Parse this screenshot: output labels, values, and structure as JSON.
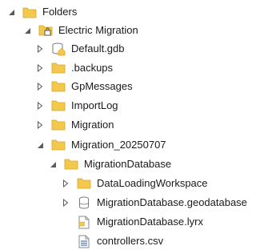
{
  "tree": {
    "folders": {
      "label": "Folders",
      "icon": "folders-icon",
      "expanded": true
    },
    "electric_migration": {
      "label": "Electric Migration",
      "icon": "folder-connection-icon",
      "expanded": true
    },
    "default_gdb": {
      "label": "Default.gdb",
      "icon": "home-geodatabase-icon",
      "expanded": false
    },
    "backups": {
      "label": ".backups",
      "icon": "folder-icon",
      "expanded": false
    },
    "gpmessages": {
      "label": "GpMessages",
      "icon": "folder-icon",
      "expanded": false
    },
    "importlog": {
      "label": "ImportLog",
      "icon": "folder-icon",
      "expanded": false
    },
    "migration": {
      "label": "Migration",
      "icon": "folder-icon",
      "expanded": false
    },
    "migration_20250707": {
      "label": "Migration_20250707",
      "icon": "folder-icon",
      "expanded": true
    },
    "migration_database": {
      "label": "MigrationDatabase",
      "icon": "folder-icon",
      "expanded": true
    },
    "data_loading_workspace": {
      "label": "DataLoadingWorkspace",
      "icon": "folder-icon",
      "expanded": false
    },
    "migration_geodatabase": {
      "label": "MigrationDatabase.geodatabase",
      "icon": "database-icon",
      "expanded": false
    },
    "migration_lyrx": {
      "label": "MigrationDatabase.lyrx",
      "icon": "layer-file-icon"
    },
    "controllers_csv": {
      "label": "controllers.csv",
      "icon": "csv-file-icon"
    }
  },
  "colors": {
    "folder_fill": "#F2C94C",
    "folder_edge": "#D9A520",
    "arrow": "#5a5a5a",
    "db_edge": "#7a7a7a",
    "csv_blue": "#3a78c8"
  }
}
